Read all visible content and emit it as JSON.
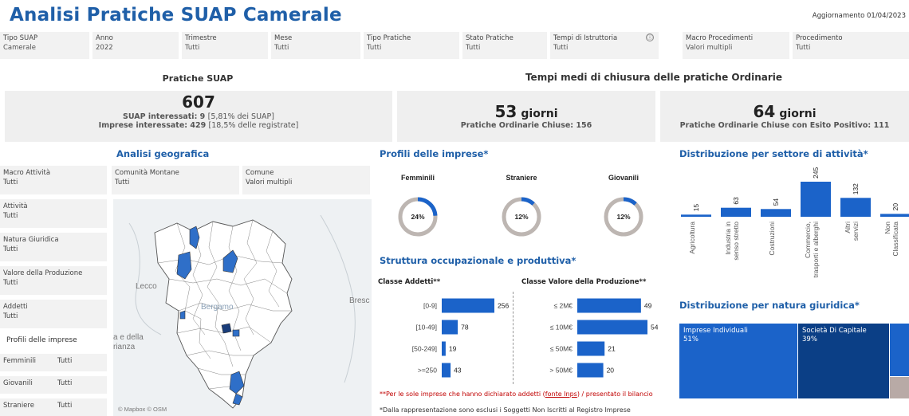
{
  "header": {
    "title": "Analisi Pratiche SUAP Camerale",
    "updated": "Aggiornamento 01/04/2023"
  },
  "filters": [
    {
      "label": "Tipo SUAP",
      "value": "Camerale"
    },
    {
      "label": "Anno",
      "value": "2022"
    },
    {
      "label": "Trimestre",
      "value": "Tutti"
    },
    {
      "label": "Mese",
      "value": "Tutti"
    },
    {
      "label": "Tipo Pratiche",
      "value": "Tutti"
    },
    {
      "label": "Stato Pratiche",
      "value": "Tutti"
    },
    {
      "label": "Tempi di Istruttoria",
      "value": "Tutti"
    },
    {
      "label": "Macro Procedimenti",
      "value": "Valori multipli"
    },
    {
      "label": "Procedimento",
      "value": "Tutti"
    }
  ],
  "info_icon": "ⓘ",
  "pratiche": {
    "heading": "Pratiche SUAP",
    "total": "607",
    "suap_label": "SUAP interessati: 9",
    "suap_note": "[5,81% dei SUAP]",
    "imprese_label": "Imprese interessate: 429",
    "imprese_note": "[18,5% delle registrate]"
  },
  "tempi": {
    "heading": "Tempi medi di chiusura delle pratiche Ordinarie",
    "left_value": "53",
    "left_unit": "giorni",
    "left_sub": "Pratiche Ordinarie Chiuse: 156",
    "right_value": "64",
    "right_unit": "giorni",
    "right_sub": "Pratiche Ordinarie Chiuse con Esito Positivo: 111"
  },
  "geo": {
    "heading": "Analisi geografica",
    "filters": [
      {
        "label": "Macro  Attività",
        "value": "Tutti"
      },
      {
        "label": "Comunità Montane",
        "value": "Tutti"
      },
      {
        "label": "Comune",
        "value": "Valori multipli"
      },
      {
        "label": "Attività",
        "value": "Tutti"
      },
      {
        "label": "Natura Giuridica",
        "value": "Tutti"
      },
      {
        "label": "Valore della Produzione",
        "value": "Tutti"
      },
      {
        "label": "Addetti",
        "value": "Tutti"
      }
    ],
    "profili_heading": "Profili delle imprese",
    "profili": [
      {
        "label": "Femminili",
        "value": "Tutti"
      },
      {
        "label": "Giovanili",
        "value": "Tutti"
      },
      {
        "label": "Straniere",
        "value": "Tutti"
      }
    ],
    "map_labels": {
      "lecco": "Lecco",
      "bergamo": "Bergamo",
      "brescia": "Bresc",
      "valle": "a e della",
      "brianza": "rianza"
    },
    "map_credit": "© Mapbox © OSM",
    "colors": {
      "highlight": "#2f6fc8",
      "dark": "#1a3d7a",
      "border": "#555555"
    }
  },
  "profili_imprese": {
    "heading": "Profili delle imprese*",
    "items": [
      {
        "label": "Femminili",
        "pct_text": "24%",
        "pct": 0.24
      },
      {
        "label": "Straniere",
        "pct_text": "12%",
        "pct": 0.12
      },
      {
        "label": "Giovanili",
        "pct_text": "12%",
        "pct": 0.12
      }
    ]
  },
  "struttura": {
    "heading": "Struttura occupazionale e produttiva*",
    "addetti_heading": "Classe Addetti**",
    "valore_heading": "Classe Valore della Produzione**",
    "note_red_pre": "**Per le sole imprese che hanno dichiarato addetti (",
    "note_red_link": "fonte Inps",
    "note_red_post": ") /  presentato il bilancio",
    "note": "*Dalla rappresentazione sono esclusi i Soggetti Non Iscritti al Registro Imprese"
  },
  "settore": {
    "heading": "Distribuzione per settore di attività*"
  },
  "natura": {
    "heading": "Distribuzione per natura giuridica*",
    "items": [
      {
        "label": "Imprese Individuali",
        "pct": "51%"
      },
      {
        "label": "Società Di Capitale",
        "pct": "39%"
      }
    ],
    "colors": {
      "individuali": "#1b63c9",
      "capitale": "#0b3f86",
      "altro": "#1b63c9",
      "grey": "#b8aaa6"
    }
  },
  "chart_data": [
    {
      "type": "bar",
      "title": "Classe Addetti**",
      "orientation": "horizontal",
      "categories": [
        "[0-9]",
        "[10-49]",
        "[50-249]",
        ">=250"
      ],
      "values": [
        256,
        78,
        19,
        43
      ]
    },
    {
      "type": "bar",
      "title": "Classe Valore della Produzione**",
      "orientation": "horizontal",
      "categories": [
        "≤ 2M€",
        "≤ 10M€",
        "≤ 50M€",
        "> 50M€"
      ],
      "values": [
        49,
        54,
        21,
        20
      ]
    },
    {
      "type": "bar",
      "title": "Distribuzione per settore di attività*",
      "categories": [
        "Agricoltura",
        "Industria in senso stretto",
        "Costruzioni",
        "Commercio, trasporti e alberghi",
        "Altri servizi",
        "Non Classificata"
      ],
      "values": [
        15,
        63,
        54,
        245,
        132,
        20
      ]
    }
  ]
}
